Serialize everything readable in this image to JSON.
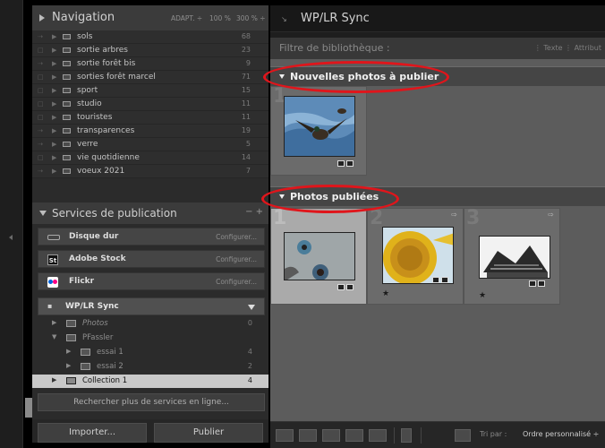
{
  "navigator": {
    "title": "Navigation",
    "zoom_options": [
      "ADAPT. ÷",
      "100 %",
      "300 % ÷"
    ]
  },
  "collections": [
    {
      "label": "sols",
      "count": "68"
    },
    {
      "label": "sortie arbres",
      "count": "23"
    },
    {
      "label": "sortie forêt bis",
      "count": "9"
    },
    {
      "label": "sorties forêt marcel",
      "count": "71"
    },
    {
      "label": "sport",
      "count": "15"
    },
    {
      "label": "studio",
      "count": "11"
    },
    {
      "label": "touristes",
      "count": "11"
    },
    {
      "label": "transparences",
      "count": "19"
    },
    {
      "label": "verre",
      "count": "5"
    },
    {
      "label": "vie quotidienne",
      "count": "14"
    },
    {
      "label": "voeux 2021",
      "count": "7"
    }
  ],
  "publish_services": {
    "title": "Services de publication",
    "header_ops": "− +",
    "services": [
      {
        "label": "Disque dur",
        "action": "Configurer..."
      },
      {
        "label": "Adobe Stock",
        "action": "Configurer...",
        "icon_text": "St"
      },
      {
        "label": "Flickr",
        "action": "Configurer..."
      }
    ],
    "wp_sync": {
      "label": "WP/LR Sync",
      "tree": [
        {
          "label": "Photos",
          "count": "0"
        },
        {
          "label": "PFassler",
          "count": ""
        },
        {
          "label": "essai 1",
          "count": "4"
        },
        {
          "label": "essai 2",
          "count": "2"
        },
        {
          "label": "Collection 1",
          "count": "4"
        }
      ]
    },
    "more_services": "Rechercher plus de services en ligne..."
  },
  "bottom_buttons": {
    "import": "Importer...",
    "publish": "Publier"
  },
  "main": {
    "title": "WP/LR Sync",
    "filter_label": "Filtre de bibliothèque :",
    "filter_options": "⋮ Texte  ⋮ Attribut",
    "section_new": "Nouvelles photos à publier",
    "section_published": "Photos publiées",
    "cell_numbers": [
      "1",
      "1",
      "2",
      "3"
    ],
    "rating_star": "★",
    "sort_label": "Tri par :",
    "sort_value": "Ordre personnalisé ÷"
  },
  "colors": {
    "highlight_ellipse": "#e0151b",
    "selected_row": "#c9c9c9",
    "adobe_stock": "#2a1a1a",
    "flickr_blue": "#0063dc",
    "flickr_pink": "#ff0084"
  },
  "icons": [
    "triangle-right-icon",
    "folder-icon",
    "harddisk-icon",
    "adobe-stock-icon",
    "flickr-icon",
    "wp-sync-icon",
    "grid-view-icon",
    "loupe-view-icon",
    "compare-view-icon",
    "survey-view-icon",
    "people-view-icon",
    "spray-can-icon",
    "sort-icon"
  ]
}
